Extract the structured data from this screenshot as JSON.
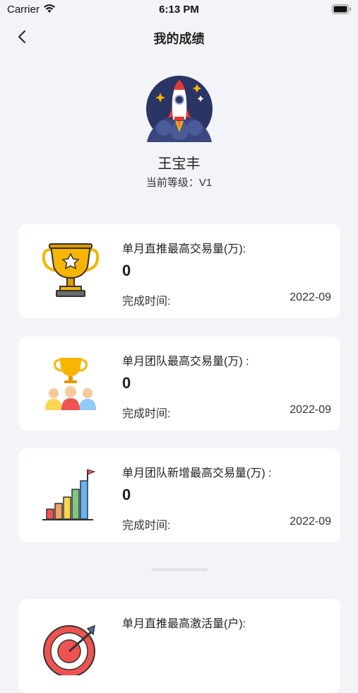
{
  "status_bar": {
    "carrier": "Carrier",
    "time": "6:13 PM"
  },
  "nav": {
    "title": "我的成绩",
    "back_icon": "chevron-left-icon"
  },
  "profile": {
    "avatar_icon": "rocket-avatar-icon",
    "name": "王宝丰",
    "level": "当前等级：V1"
  },
  "cards": [
    {
      "icon": "trophy-icon",
      "title": "单月直推最高交易量(万):",
      "value": "0",
      "time_label": "完成时间:",
      "time_value": "2022-09"
    },
    {
      "icon": "team-trophy-icon",
      "title": "单月团队最高交易量(万) :",
      "value": "0",
      "time_label": "完成时间:",
      "time_value": "2022-09"
    },
    {
      "icon": "growth-chart-icon",
      "title": "单月团队新增最高交易量(万) :",
      "value": "0",
      "time_label": "完成时间:",
      "time_value": "2022-09"
    },
    {
      "icon": "target-icon",
      "title": "单月直推最高激活量(户):"
    }
  ],
  "colors": {
    "background": "#f3f4f8",
    "card": "#ffffff",
    "trophy_gold": "#f7b500",
    "avatar_bg": "#2a3565"
  }
}
